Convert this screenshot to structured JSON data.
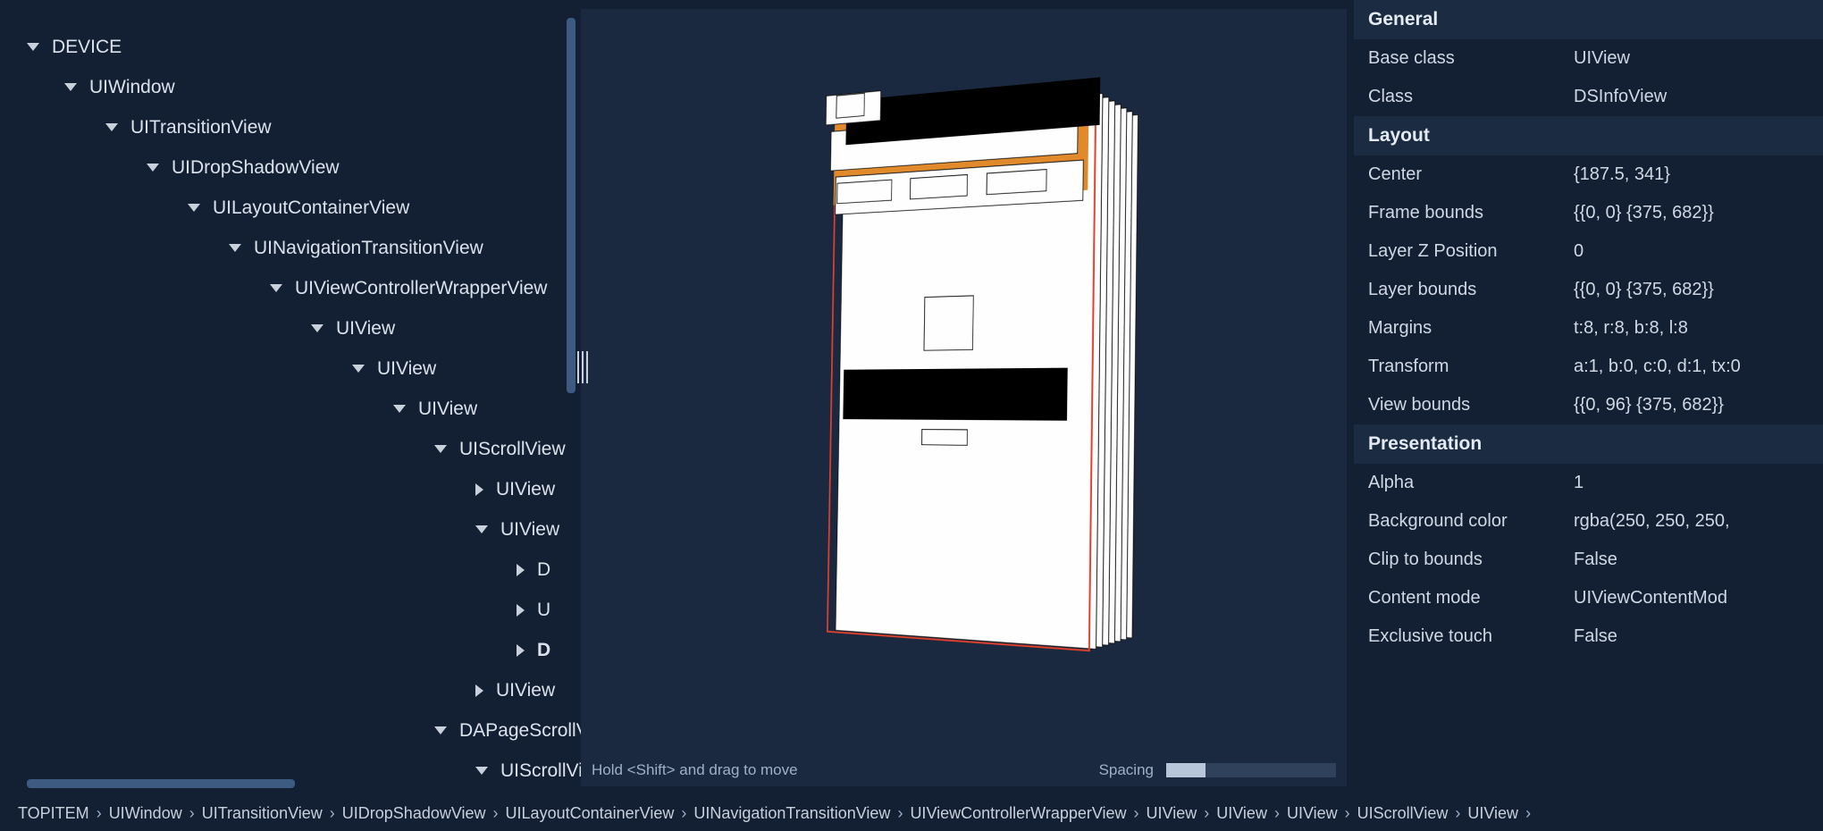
{
  "tree": {
    "items": [
      {
        "label": "DEVICE",
        "depth": 0,
        "open": true,
        "bold": false
      },
      {
        "label": "UIWindow",
        "depth": 1,
        "open": true,
        "bold": false
      },
      {
        "label": "UITransitionView",
        "depth": 2,
        "open": true,
        "bold": false
      },
      {
        "label": "UIDropShadowView",
        "depth": 3,
        "open": true,
        "bold": false
      },
      {
        "label": "UILayoutContainerView",
        "depth": 4,
        "open": true,
        "bold": false
      },
      {
        "label": "UINavigationTransitionView",
        "depth": 5,
        "open": true,
        "bold": false
      },
      {
        "label": "UIViewControllerWrapperView",
        "depth": 6,
        "open": true,
        "bold": false
      },
      {
        "label": "UIView",
        "depth": 7,
        "open": true,
        "bold": false
      },
      {
        "label": "UIView",
        "depth": 8,
        "open": true,
        "bold": false
      },
      {
        "label": "UIView",
        "depth": 9,
        "open": true,
        "bold": false
      },
      {
        "label": "UIScrollView",
        "depth": 10,
        "open": true,
        "bold": false
      },
      {
        "label": "UIView",
        "depth": 11,
        "open": false,
        "bold": false
      },
      {
        "label": "UIView",
        "depth": 11,
        "open": true,
        "bold": false
      },
      {
        "label": "D",
        "depth": 12,
        "open": false,
        "bold": false
      },
      {
        "label": "U",
        "depth": 12,
        "open": false,
        "bold": false
      },
      {
        "label": "D",
        "depth": 12,
        "open": false,
        "bold": true
      },
      {
        "label": "UIView",
        "depth": 11,
        "open": false,
        "bold": false
      },
      {
        "label": "DAPageScrollView",
        "depth": 10,
        "open": true,
        "bold": false
      },
      {
        "label": "UIScrollView",
        "depth": 11,
        "open": true,
        "bold": false
      }
    ]
  },
  "canvas": {
    "hint": "Hold <Shift> and drag to move",
    "spacing_label": "Spacing"
  },
  "properties": {
    "sections": [
      {
        "title": "General",
        "rows": [
          {
            "k": "Base class",
            "v": "UIView"
          },
          {
            "k": "Class",
            "v": "DSInfoView"
          }
        ]
      },
      {
        "title": "Layout",
        "rows": [
          {
            "k": "Center",
            "v": "{187.5, 341}"
          },
          {
            "k": "Frame bounds",
            "v": "{{0, 0} {375, 682}}"
          },
          {
            "k": "Layer Z Position",
            "v": "0"
          },
          {
            "k": "Layer bounds",
            "v": "{{0, 0} {375, 682}}"
          },
          {
            "k": "Margins",
            "v": "t:8, r:8, b:8, l:8"
          },
          {
            "k": "Transform",
            "v": "a:1, b:0, c:0, d:1, tx:0"
          },
          {
            "k": "View bounds",
            "v": "{{0, 96} {375, 682}}"
          }
        ]
      },
      {
        "title": "Presentation",
        "rows": [
          {
            "k": "Alpha",
            "v": "1"
          },
          {
            "k": "Background color",
            "v": "rgba(250, 250, 250,"
          },
          {
            "k": "Clip to bounds",
            "v": "False"
          },
          {
            "k": "Content mode",
            "v": "UIViewContentMod"
          },
          {
            "k": "Exclusive touch",
            "v": "False"
          }
        ]
      }
    ]
  },
  "breadcrumb": [
    "TOPITEM",
    "UIWindow",
    "UITransitionView",
    "UIDropShadowView",
    "UILayoutContainerView",
    "UINavigationTransitionView",
    "UIViewControllerWrapperView",
    "UIView",
    "UIView",
    "UIView",
    "UIScrollView",
    "UIView"
  ]
}
